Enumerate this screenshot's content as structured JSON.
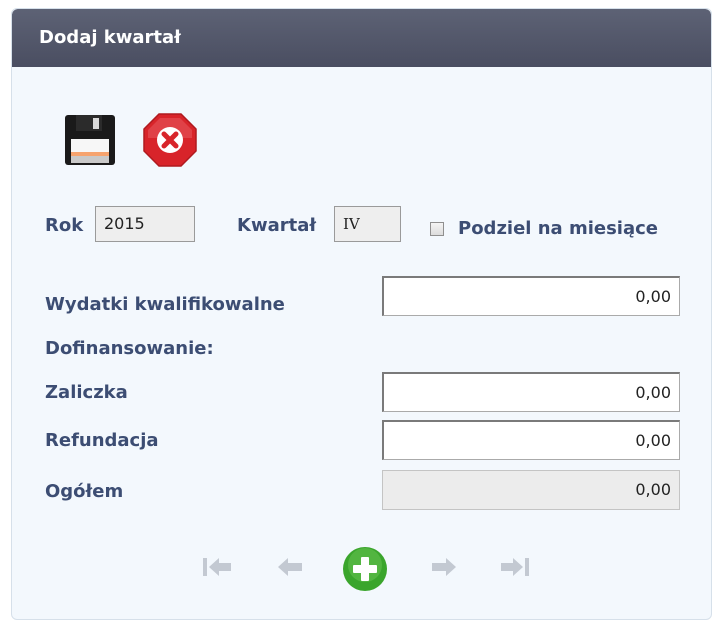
{
  "dialog": {
    "title": "Dodaj kwartał"
  },
  "toolbar": {
    "save_icon": "floppy-disk-icon",
    "cancel_icon": "stop-x-icon",
    "cancel_color": "#d8242a"
  },
  "form": {
    "rok_label": "Rok",
    "rok_value": "2015",
    "kwartal_label": "Kwartał",
    "kwartal_value": "IV",
    "podziel_label": "Podziel na miesiące",
    "podziel_checked": false,
    "wydatki_label": "Wydatki kwalifikowalne",
    "wydatki_value": "0,00",
    "dofinansowanie_label": "Dofinansowanie:",
    "zaliczka_label": "Zaliczka",
    "zaliczka_value": "0,00",
    "refundacja_label": "Refundacja",
    "refundacja_value": "0,00",
    "ogolem_label": "Ogółem",
    "ogolem_value": "0,00"
  },
  "navigation": {
    "first_icon": "first-page-icon",
    "prev_icon": "previous-arrow-icon",
    "add_icon": "add-plus-icon",
    "next_icon": "next-arrow-icon",
    "last_icon": "last-page-icon",
    "add_color": "#3aa52c"
  }
}
